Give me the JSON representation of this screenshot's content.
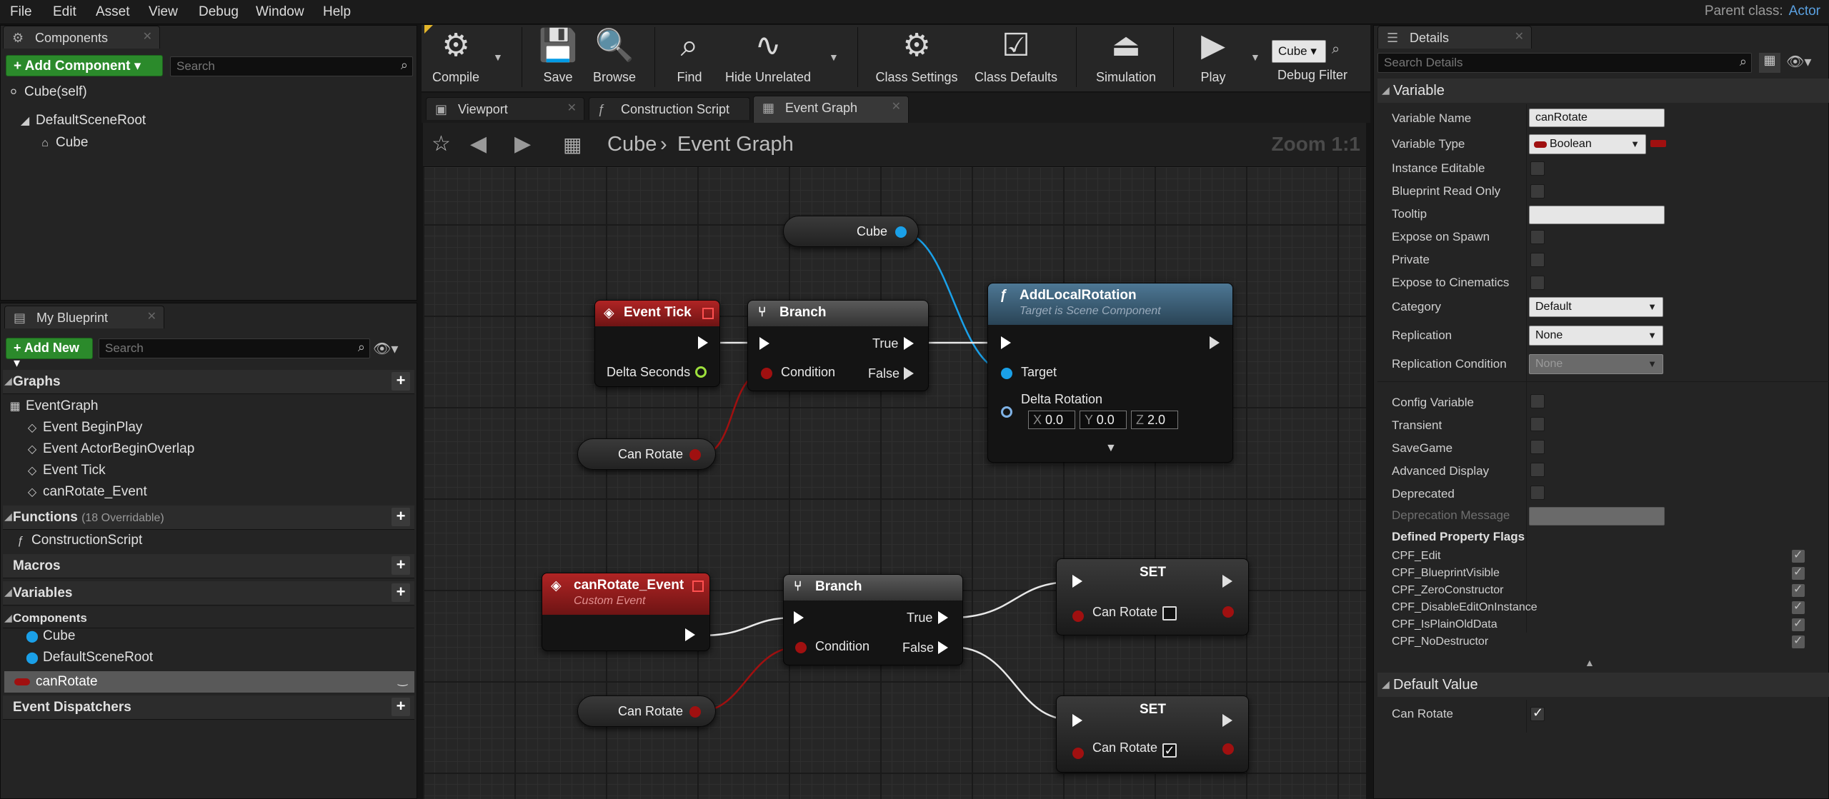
{
  "menu": [
    "File",
    "Edit",
    "Asset",
    "View",
    "Debug",
    "Window",
    "Help"
  ],
  "parent_class": {
    "label": "Parent class:",
    "value": "Actor"
  },
  "components_panel": {
    "tab": "Components",
    "add_button": "+ Add Component ▾",
    "search_placeholder": "Search",
    "self_item": "Cube(self)",
    "tree": [
      "DefaultSceneRoot",
      "Cube"
    ]
  },
  "my_blueprint": {
    "tab": "My Blueprint",
    "add_button": "+ Add New ▾",
    "search_placeholder": "Search",
    "graphs_header": "Graphs",
    "graphs": [
      "EventGraph",
      "Event BeginPlay",
      "Event ActorBeginOverlap",
      "Event Tick",
      "canRotate_Event"
    ],
    "functions_header": "Functions",
    "functions_note": "(18 Overridable)",
    "functions": [
      "ConstructionScript"
    ],
    "macros_header": "Macros",
    "variables_header": "Variables",
    "components_sub": "Components",
    "variable_components": [
      "Cube",
      "DefaultSceneRoot"
    ],
    "selected_variable": "canRotate",
    "dispatchers_header": "Event Dispatchers"
  },
  "toolbar": {
    "compile": "Compile",
    "save": "Save",
    "browse": "Browse",
    "find": "Find",
    "hide_unrelated": "Hide Unrelated",
    "class_settings": "Class Settings",
    "class_defaults": "Class Defaults",
    "simulation": "Simulation",
    "play": "Play",
    "debug_object": "Cube",
    "debug_filter": "Debug Filter"
  },
  "editor_tabs": [
    "Viewport",
    "Construction Script",
    "Event Graph"
  ],
  "breadcrumb": {
    "root": "Cube",
    "current": "Event Graph",
    "zoom": "Zoom 1:1"
  },
  "nodes": {
    "cube_var": "Cube",
    "event_tick": {
      "title": "Event Tick",
      "out": "Delta Seconds"
    },
    "branch1": {
      "title": "Branch",
      "condition": "Condition",
      "true": "True",
      "false": "False"
    },
    "can_rotate_1": "Can Rotate",
    "add_local_rotation": {
      "title": "AddLocalRotation",
      "subtitle": "Target is Scene Component",
      "target": "Target",
      "delta": "Delta Rotation",
      "x_label": "X",
      "x": "0.0",
      "y_label": "Y",
      "y": "0.0",
      "z_label": "Z",
      "z": "2.0"
    },
    "custom_event": {
      "title": "canRotate_Event",
      "subtitle": "Custom Event"
    },
    "branch2": {
      "title": "Branch",
      "condition": "Condition",
      "true": "True",
      "false": "False"
    },
    "can_rotate_2": "Can Rotate",
    "set1": {
      "title": "SET",
      "pin": "Can Rotate"
    },
    "set2": {
      "title": "SET",
      "pin": "Can Rotate"
    }
  },
  "details": {
    "tab": "Details",
    "search_placeholder": "Search Details",
    "variable_header": "Variable",
    "variable_name_label": "Variable Name",
    "variable_name": "canRotate",
    "variable_type_label": "Variable Type",
    "variable_type": "Boolean",
    "instance_editable": "Instance Editable",
    "blueprint_read_only": "Blueprint Read Only",
    "tooltip": "Tooltip",
    "expose_on_spawn": "Expose on Spawn",
    "private": "Private",
    "expose_to_cinematics": "Expose to Cinematics",
    "category_label": "Category",
    "category": "Default",
    "replication_label": "Replication",
    "replication": "None",
    "replication_condition_label": "Replication Condition",
    "replication_condition": "None",
    "config_variable": "Config Variable",
    "transient": "Transient",
    "savegame": "SaveGame",
    "advanced_display": "Advanced Display",
    "deprecated": "Deprecated",
    "deprecation_message": "Deprecation Message",
    "flags_header": "Defined Property Flags",
    "flags": [
      "CPF_Edit",
      "CPF_BlueprintVisible",
      "CPF_ZeroConstructor",
      "CPF_DisableEditOnInstance",
      "CPF_IsPlainOldData",
      "CPF_NoDestructor"
    ],
    "default_value_header": "Default Value",
    "default_can_rotate": "Can Rotate"
  },
  "colors": {
    "bool_pin": "#a01010",
    "object_pin": "#1aa0e8",
    "float_pin": "#9de03c",
    "event_header": "#8e1b1b",
    "function_header": "#3a5f78",
    "green_button": "#2b8a2b"
  }
}
